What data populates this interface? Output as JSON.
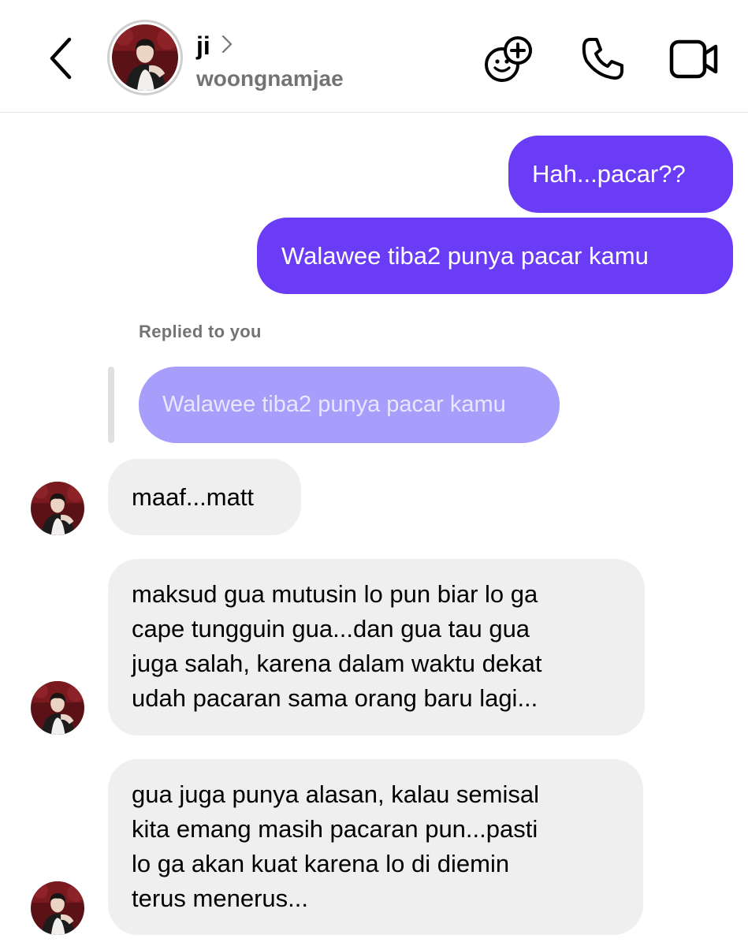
{
  "header": {
    "name": "ji",
    "username": "woongnamjae",
    "icons": [
      "back-chevron-icon",
      "chevron-right-icon",
      "stickers-add-icon",
      "phone-icon",
      "video-camera-icon"
    ]
  },
  "messages": {
    "sent": [
      "Hah...pacar??",
      "Walawee tiba2 punya pacar kamu"
    ],
    "reply_label": "Replied to you",
    "reply_quote": "Walawee tiba2 punya pacar kamu",
    "received": [
      {
        "lines": [
          "maaf...matt"
        ]
      },
      {
        "lines": [
          "maksud gua mutusin lo pun biar lo ga",
          "cape tungguin gua...dan gua tau gua",
          "juga salah, karena dalam waktu dekat",
          "udah pacaran sama orang baru lagi..."
        ]
      },
      {
        "lines": [
          "gua juga punya alasan, kalau semisal",
          "kita emang masih pacaran pun...pasti",
          "lo ga akan kuat karena lo di diemin",
          "terus menerus..."
        ]
      }
    ]
  },
  "colors": {
    "sent_bubble": "#6a3cf6",
    "received_bubble": "#efefef",
    "reply_bubble": "#a79dfa",
    "muted_text": "#737373"
  }
}
